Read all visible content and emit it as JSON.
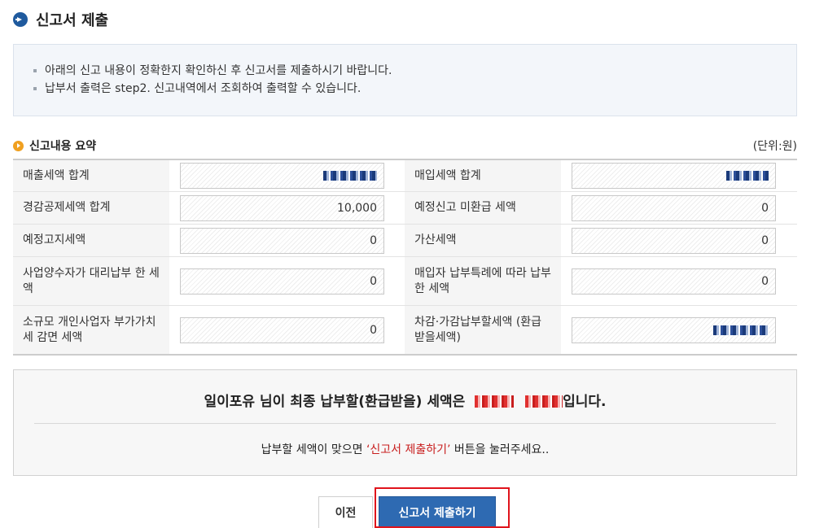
{
  "page": {
    "title": "신고서 제출",
    "icons": {
      "title": "arrow-right-circle-icon",
      "section": "orange-bullet-icon"
    },
    "colors": {
      "accent": "#2e6ab2",
      "highlight": "#e0141c",
      "emphasis": "#c81e1e"
    }
  },
  "notice": {
    "items": [
      "아래의 신고 내용이 정확한지 확인하신 후 신고서를 제출하시기 바랍니다.",
      "납부서 출력은 step2. 신고내역에서 조회하여 출력할 수 있습니다."
    ]
  },
  "summary": {
    "title": "신고내용 요약",
    "unit": "(단위:원)",
    "rows": [
      {
        "left": {
          "label": "매출세액 합계",
          "value": ""
        },
        "right": {
          "label": "매입세액 합계",
          "value": ""
        }
      },
      {
        "left": {
          "label": "경감공제세액 합계",
          "value": "10,000"
        },
        "right": {
          "label": "예정신고 미환급 세액",
          "value": "0"
        }
      },
      {
        "left": {
          "label": "예정고지세액",
          "value": "0"
        },
        "right": {
          "label": "가산세액",
          "value": "0"
        }
      },
      {
        "left": {
          "label": "사업양수자가 대리납부 한 세액",
          "value": "0"
        },
        "right": {
          "label": "매입자 납부특례에 따라 납부한 세액",
          "value": "0"
        }
      },
      {
        "left": {
          "label": "소규모 개인사업자 부가가치세 감면 세액",
          "value": "0"
        },
        "right": {
          "label": "차감·가감납부할세액 (환급받을세액)",
          "value": ""
        }
      }
    ]
  },
  "final": {
    "prefix": "일이포유 님이 최종 납부할(환급받을) 세액은",
    "suffix": "입니다.",
    "note_before": "납부할 세액이 맞으면 ",
    "note_highlight": "‘신고서 제출하기’",
    "note_after": " 버튼을 눌러주세요.."
  },
  "buttons": {
    "prev": "이전",
    "submit": "신고서 제출하기"
  }
}
